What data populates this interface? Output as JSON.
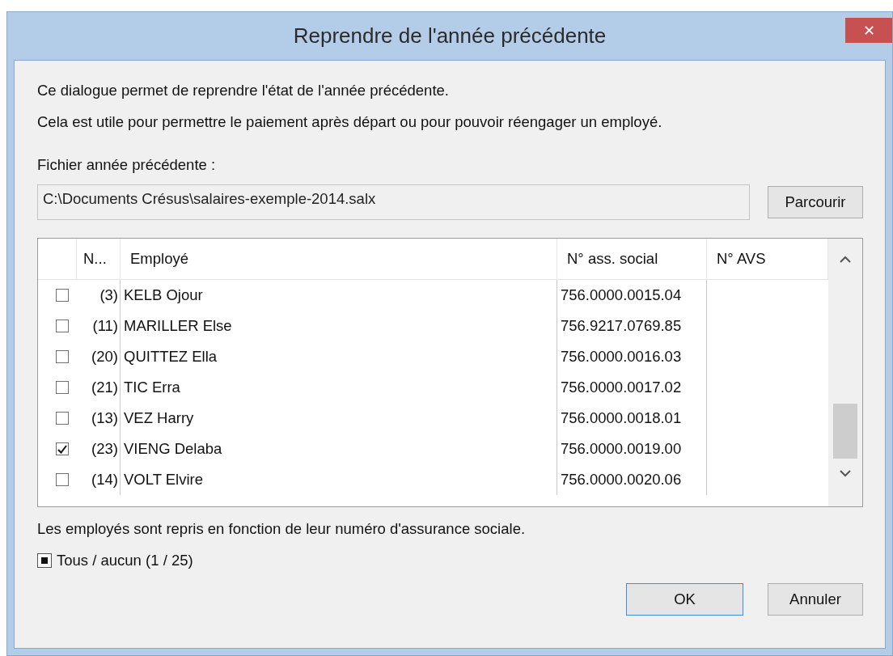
{
  "window": {
    "title": "Reprendre de l'année précédente",
    "close": "✕"
  },
  "intro": [
    "Ce dialogue permet de reprendre l'état de l'année précédente.",
    "Cela est utile pour permettre le paiement après départ ou pour pouvoir réengager un employé."
  ],
  "file": {
    "label": "Fichier année précédente :",
    "value": "C:\\Documents Crésus\\salaires-exemple-2014.salx",
    "browse": "Parcourir"
  },
  "table": {
    "columns": [
      "N...",
      "Employé",
      "N° ass. social",
      "N° AVS"
    ],
    "rows": [
      {
        "number": "(3)",
        "name": "KELB Ojour",
        "social": "756.0000.0015.04",
        "checked": false
      },
      {
        "number": "(11)",
        "name": "MARILLER Else",
        "social": "756.9217.0769.85",
        "checked": false
      },
      {
        "number": "(20)",
        "name": "QUITTEZ Ella",
        "social": "756.0000.0016.03",
        "checked": false
      },
      {
        "number": "(21)",
        "name": "TIC Erra",
        "social": "756.0000.0017.02",
        "checked": false
      },
      {
        "number": "(13)",
        "name": "VEZ Harry",
        "social": "756.0000.0018.01",
        "checked": false
      },
      {
        "number": "(23)",
        "name": "VIENG Delaba",
        "social": "756.0000.0019.00",
        "checked": true
      },
      {
        "number": "(14)",
        "name": "VOLT Elvire",
        "social": "756.0000.0020.06",
        "checked": false
      }
    ]
  },
  "note": "Les employés sont repris en fonction de leur numéro d'assurance sociale.",
  "select_all": {
    "label": "Tous / aucun (1 / 25)",
    "mixed": true
  },
  "buttons": [
    {
      "label": "OK",
      "default": true
    },
    {
      "label": "Annuler",
      "default": false
    }
  ]
}
